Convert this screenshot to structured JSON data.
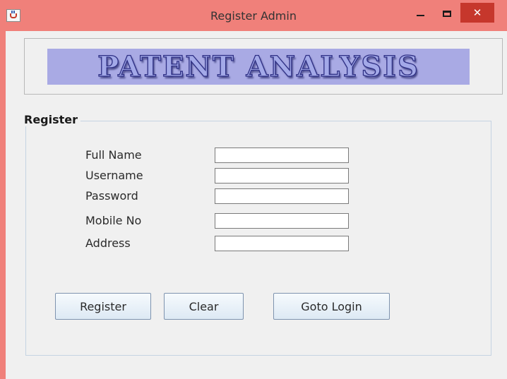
{
  "window": {
    "title": "Register Admin",
    "min_symbol": "",
    "max_symbol": "",
    "close_symbol": "✕",
    "colors": {
      "titlebar": "#f0807a",
      "close": "#c6372c",
      "client": "#f0f0f0"
    }
  },
  "banner": {
    "text": "PATENT ANALYSIS"
  },
  "form": {
    "legend": "Register",
    "fields": [
      {
        "label": "Full Name",
        "value": "",
        "placeholder": ""
      },
      {
        "label": "Username",
        "value": "",
        "placeholder": ""
      },
      {
        "label": "Password",
        "value": "",
        "placeholder": ""
      },
      {
        "label": "Mobile No",
        "value": "",
        "placeholder": ""
      },
      {
        "label": "Address",
        "value": "",
        "placeholder": ""
      }
    ]
  },
  "buttons": {
    "register": "Register",
    "clear": "Clear",
    "goto_login": "Goto Login"
  },
  "icons": {
    "app": "java-cup-icon",
    "minimize": "minimize-icon",
    "maximize": "maximize-icon",
    "close": "close-icon"
  }
}
